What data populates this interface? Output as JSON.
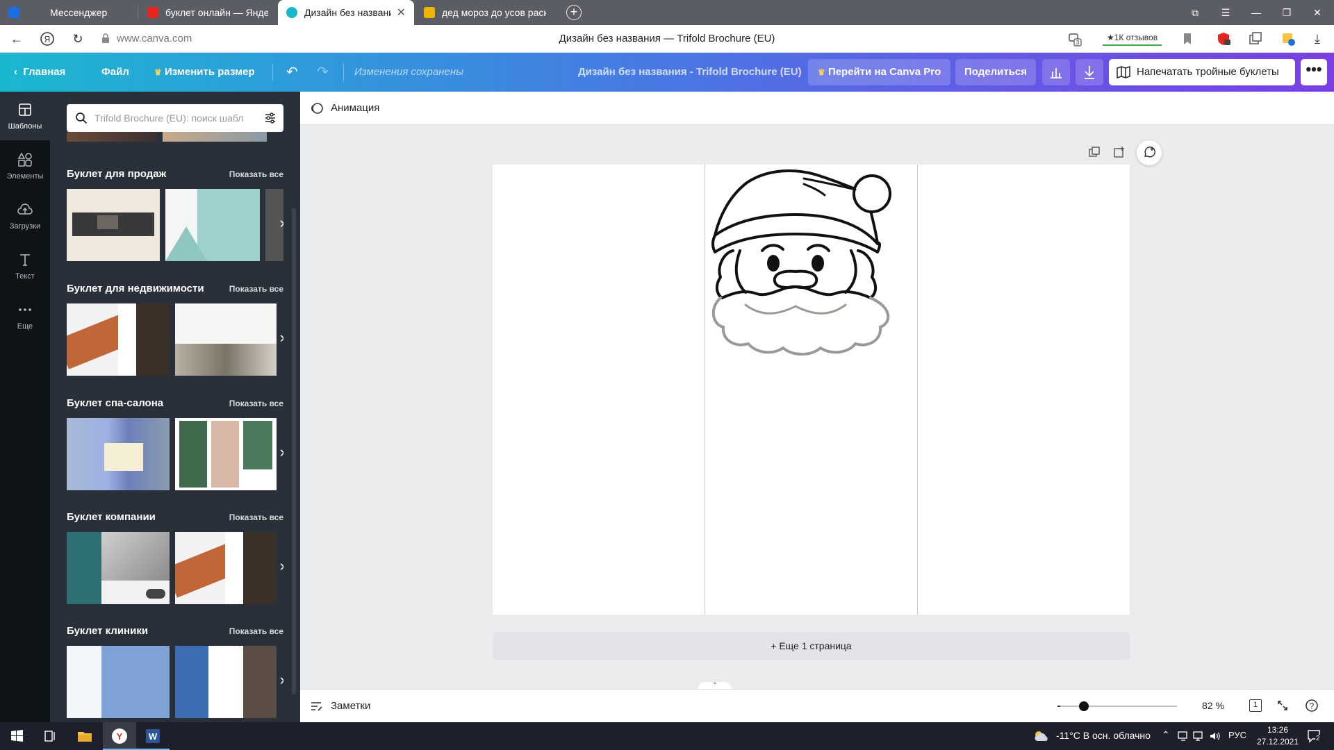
{
  "browser": {
    "tabs": [
      {
        "label": "Мессенджер",
        "favicon_color": "#1c6fe0"
      },
      {
        "label": "буклет онлайн — Яндекс",
        "favicon_color": "#e52620"
      },
      {
        "label": "Дизайн без названия — ",
        "favicon_color": "#18b6c9"
      },
      {
        "label": "дед мороз до усов раскра",
        "favicon_color": "#f0b400"
      }
    ],
    "url": "www.canva.com",
    "page_title": "Дизайн без названия — Trifold Brochure (EU)",
    "reviews_label": "★1К отзывов",
    "notif_count": "3"
  },
  "canva_header": {
    "home": "Главная",
    "file": "Файл",
    "resize": "Изменить размер",
    "saved_status": "Изменения сохранены",
    "design_title": "Дизайн без названия - Trifold Brochure (EU)",
    "go_pro": "Перейти на Canva Pro",
    "share": "Поделиться",
    "print": "Напечатать тройные буклеты",
    "more": "•••"
  },
  "rail": [
    {
      "label": "Шаблоны",
      "icon": "templates-icon"
    },
    {
      "label": "Элементы",
      "icon": "elements-icon"
    },
    {
      "label": "Загрузки",
      "icon": "uploads-icon"
    },
    {
      "label": "Текст",
      "icon": "text-icon"
    },
    {
      "label": "Еще",
      "icon": "more-icon"
    }
  ],
  "panel": {
    "search_placeholder": "Trifold Brochure (EU): поиск шабл",
    "show_all": "Показать все",
    "sections": [
      {
        "title": "Буклет для продаж"
      },
      {
        "title": "Буклет для недвижимости"
      },
      {
        "title": "Буклет спа-салона"
      },
      {
        "title": "Буклет компании"
      },
      {
        "title": "Буклет клиники"
      }
    ]
  },
  "editor": {
    "animation_label": "Анимация",
    "add_page": "+ Еще 1 страница",
    "notes_label": "Заметки",
    "zoom": "82 %",
    "zoom_fraction": 0.2,
    "page_number": "1"
  },
  "taskbar": {
    "weather": "-11°C  В осн. облачно",
    "lang": "РУС",
    "time": "13:26",
    "date": "27.12.2021",
    "notifications": "2"
  },
  "colors": {
    "canva_gradient_start": "#1ab7d0",
    "canva_gradient_end": "#7a3fe4",
    "panel_bg": "#293039",
    "rail_bg": "#0e1318"
  }
}
